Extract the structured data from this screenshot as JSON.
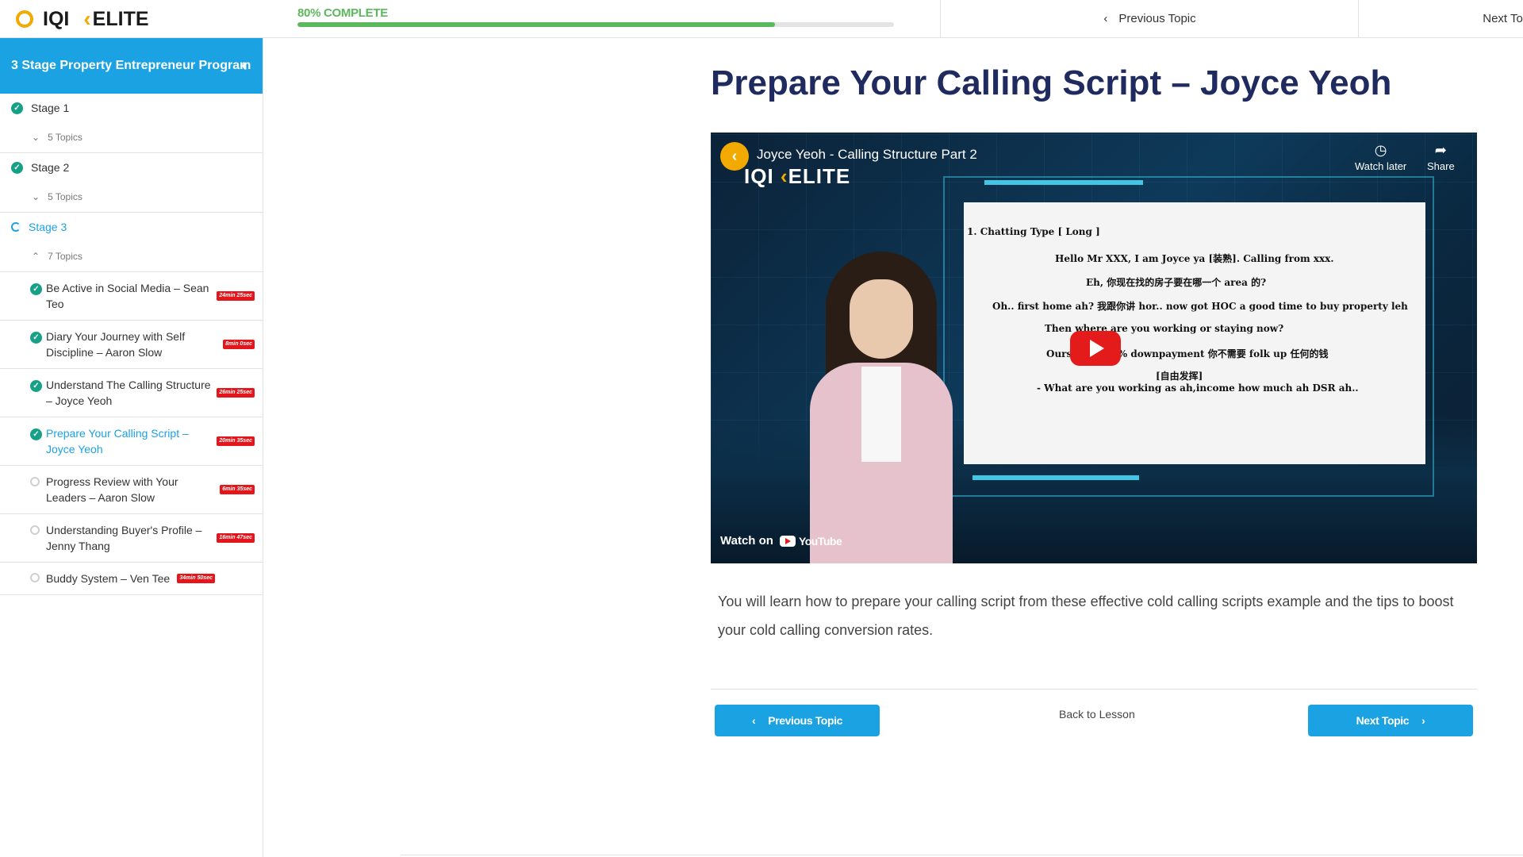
{
  "brand": {
    "logo_left": "IQI",
    "logo_right": "ELITE",
    "accent": "#f2a900"
  },
  "progress": {
    "label": "80% COMPLETE",
    "value": 0.8,
    "color": "#5cb85c"
  },
  "top_nav": {
    "prev_label": "Previous Topic",
    "next_label": "Next Topic"
  },
  "sidebar": {
    "course_title": "3 Stage Property Entrepreneur Program",
    "header_color": "#1ba2e3",
    "stages": [
      {
        "label": "Stage 1",
        "topics": "5 Topics"
      },
      {
        "label": "Stage 2",
        "topics": "5 Topics"
      },
      {
        "label": "Stage 3",
        "topics": "7 Topics"
      }
    ],
    "lessons": [
      {
        "title": "Be Active in Social Media – Sean Teo",
        "badge": "24min 25sec"
      },
      {
        "title": "Diary Your Journey with Self Discipline – Aaron Slow",
        "badge": "8min 0sec"
      },
      {
        "title": "Understand The Calling Structure – Joyce Yeoh",
        "badge": "26min 25sec"
      },
      {
        "title": "Prepare Your Calling Script – Joyce Yeoh",
        "badge": "20min 35sec"
      },
      {
        "title": "Progress Review with Your Leaders – Aaron Slow",
        "badge": "6min 35sec"
      },
      {
        "title": "Understanding Buyer's Profile – Jenny Thang",
        "badge": "16min 47sec"
      },
      {
        "title": "Buddy System – Ven Tee",
        "badge": "34min 50sec"
      }
    ]
  },
  "main": {
    "title": "Prepare Your Calling Script – Joyce Yeoh",
    "video": {
      "title": "Joyce Yeoh - Calling Structure Part 2",
      "overlay_logo_left": "IQI",
      "overlay_logo_right": "ELITE",
      "watch_later": "Watch later",
      "share": "Share",
      "watch_on": "Watch on",
      "youtube": "YouTube",
      "slide_lines": [
        "1. Chatting Type [ Long ]",
        "Hello Mr XXX, I am Joyce ya [装熟]. Calling from xxx.",
        "Eh, 你现在找的房子要在哪一个 area 的?",
        "Oh.. first home ah? 我跟你讲 hor.. now got HOC a good time to buy property leh",
        "Then where are you working or staying now?",
        "Ours hor, is 0% downpayment 你不需要 folk up 任何的钱",
        "[自由发挥]",
        "- What are you working as ah,income how much ah DSR ah.."
      ]
    },
    "description": "You will learn how to prepare your calling script from these effective cold calling scripts example and the tips to boost your cold calling conversion rates.",
    "prev_button": "Previous Topic",
    "back_link": "Back to Lesson",
    "next_button": "Next Topic"
  }
}
